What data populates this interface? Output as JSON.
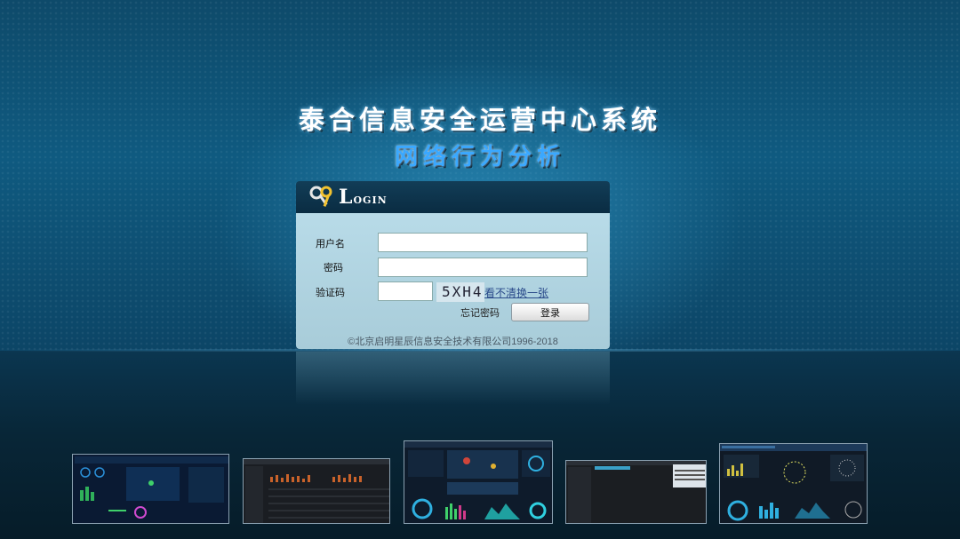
{
  "header": {
    "title": "泰合信息安全运营中心系统",
    "subtitle": "网络行为分析"
  },
  "login": {
    "title": "Login",
    "username_label": "用户名",
    "username_value": "",
    "password_label": "密码",
    "password_value": "",
    "captcha_label": "验证码",
    "captcha_value": "",
    "captcha_image_text": "5XH4",
    "refresh_captcha": "看不清换一张",
    "forgot_password": "忘记密码",
    "submit": "登录",
    "copyright": "©北京启明星辰信息安全技术有限公司1996-2018"
  },
  "colors": {
    "title": "#ffffff",
    "subtitle": "#3aa8ff",
    "panel": "#b8dbe8",
    "header_bar": "#0a2c42"
  },
  "showcase": {
    "thumbnails": [
      "dashboard-1",
      "dashboard-2",
      "dashboard-3",
      "dashboard-4",
      "dashboard-5"
    ]
  }
}
